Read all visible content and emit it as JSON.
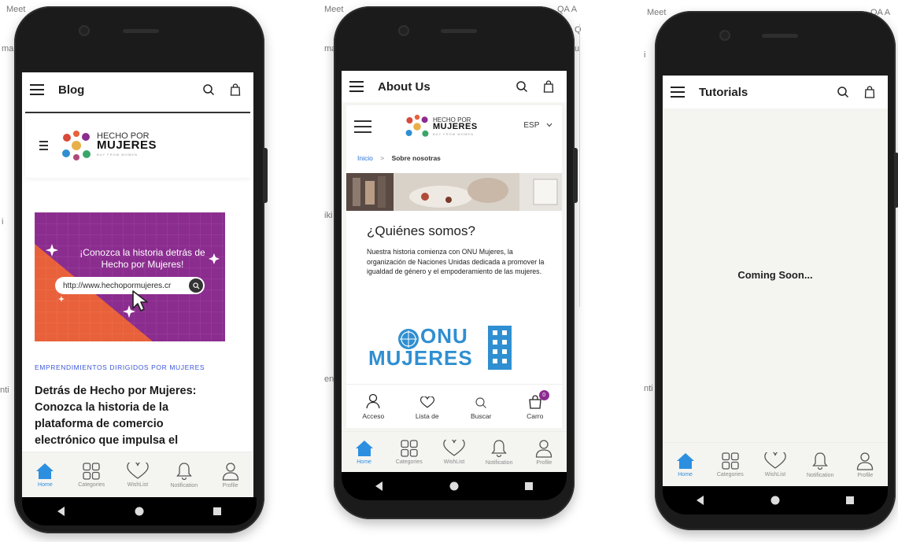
{
  "background": {
    "fragments": [
      "Meet",
      "mai",
      "iki",
      "i",
      "enti",
      "nti",
      "QA A",
      "Q",
      "u",
      "Meet",
      "Meet",
      "mai",
      "i",
      "nti",
      "QA A"
    ]
  },
  "phones": [
    {
      "appbar": {
        "title": "Blog"
      },
      "site": {
        "logo_top": "HECHO POR",
        "logo_main": "MUJERES",
        "logo_tagline": "BUY FROM WOMEN"
      },
      "banner": {
        "headline": "¡Conozca la historia detrás de Hecho por Mujeres!",
        "url": "http://www.hechopormujeres.cr"
      },
      "post": {
        "category": "EMPRENDIMIENTOS DIRIGIDOS POR MUJERES",
        "title": "Detrás de Hecho por Mujeres: Conozca la historia de la plataforma de comercio electrónico que impulsa el"
      },
      "nav": [
        {
          "label": "Home",
          "icon": "home-icon",
          "active": true
        },
        {
          "label": "Categories",
          "icon": "grid-icon",
          "active": false
        },
        {
          "label": "WishList",
          "icon": "heart-icon",
          "active": false
        },
        {
          "label": "Notification",
          "icon": "bell-icon",
          "active": false
        },
        {
          "label": "Profile",
          "icon": "person-icon",
          "active": false
        }
      ]
    },
    {
      "appbar": {
        "title": "About Us"
      },
      "site": {
        "logo_top": "HECHO POR",
        "logo_main": "MUJERES",
        "logo_tagline": "BUY FROM WOMEN",
        "lang": "ESP"
      },
      "breadcrumb": {
        "home": "Inicio",
        "sep": ">",
        "current": "Sobre nosotras"
      },
      "about": {
        "heading": "¿Quiénes somos?",
        "text": "Nuestra historia comienza con ONU Mujeres, la organización de Naciones Unidas dedicada a promover la igualdad de género y el empoderamiento de las mujeres."
      },
      "onu": {
        "line1": "ONU",
        "line2": "MUJERES"
      },
      "shopbar": [
        {
          "label": "Acceso",
          "icon": "user-icon"
        },
        {
          "label": "Lista de",
          "icon": "heart-icon"
        },
        {
          "label": "Buscar",
          "icon": "search-icon"
        },
        {
          "label": "Carro",
          "icon": "cart-icon",
          "badge": "0"
        }
      ],
      "nav": [
        {
          "label": "Home",
          "icon": "home-icon",
          "active": true
        },
        {
          "label": "Categories",
          "icon": "grid-icon",
          "active": false
        },
        {
          "label": "WishList",
          "icon": "heart-icon",
          "active": false
        },
        {
          "label": "Notification",
          "icon": "bell-icon",
          "active": false
        },
        {
          "label": "Profile",
          "icon": "person-icon",
          "active": false
        }
      ]
    },
    {
      "appbar": {
        "title": "Tutorials"
      },
      "message": "Coming Soon...",
      "nav": [
        {
          "label": "Home",
          "icon": "home-icon",
          "active": true
        },
        {
          "label": "Categories",
          "icon": "grid-icon",
          "active": false
        },
        {
          "label": "WishList",
          "icon": "heart-icon",
          "active": false
        },
        {
          "label": "Notification",
          "icon": "bell-icon",
          "active": false
        },
        {
          "label": "Profile",
          "icon": "person-icon",
          "active": false
        }
      ]
    }
  ],
  "colors": {
    "accent": "#2d8fe0",
    "brand_purple": "#8b2c8f",
    "banner_orange": "#e8613a",
    "onu_blue": "#2f8fd1",
    "link_blue": "#3a57d8"
  }
}
